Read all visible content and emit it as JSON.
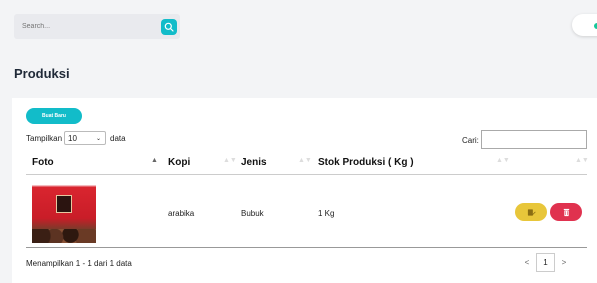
{
  "search": {
    "placeholder": "Search..."
  },
  "page": {
    "title": "Produksi"
  },
  "toolbar": {
    "new_button": "Buat Baru",
    "length_prefix": "Tampilkan",
    "length_value": "10",
    "length_suffix": "data",
    "filter_label": "Cari:"
  },
  "table": {
    "columns": [
      "Foto",
      "Kopi",
      "Jenis",
      "Stok Produksi ( Kg )",
      ""
    ],
    "rows": [
      {
        "kopi": "arabika",
        "jenis": "Bubuk",
        "stok": "1 Kg"
      }
    ]
  },
  "footer": {
    "info": "Menampilkan 1 - 1 dari 1 data",
    "prev": "<",
    "page": "1",
    "next": ">"
  },
  "colors": {
    "accent": "#12bcc9",
    "edit": "#e8c63a",
    "delete": "#e0324f",
    "toggle_dot": "#16c79a"
  },
  "icons": {
    "search": "search-icon",
    "edit": "edit-icon",
    "delete": "trash-icon",
    "sort": "sort-icon"
  }
}
